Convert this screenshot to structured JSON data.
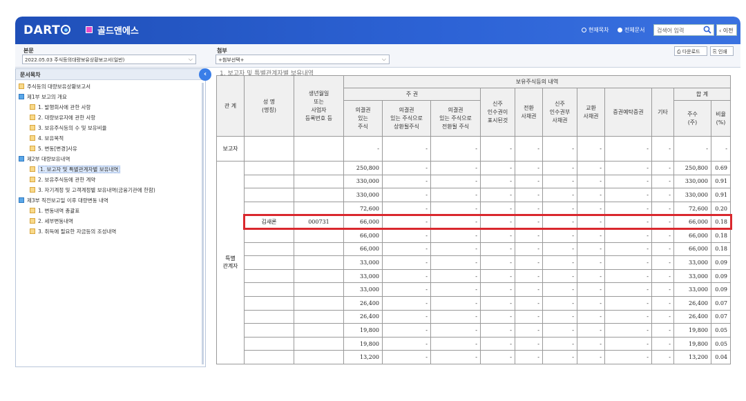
{
  "header": {
    "logo": "DART",
    "company_name": "골드앤에스",
    "radio_current": "현재목차",
    "radio_all": "전체문서",
    "search_placeholder": "검색어 입력",
    "prev_label": "이전"
  },
  "subbar": {
    "report_label": "본문",
    "report_value": "2022.05.03  주식등의대량보유상황보고서(일반)",
    "attach_label": "첨부",
    "attach_value": "+첨부선택+",
    "download_label": "다운로드",
    "print_label": "인쇄"
  },
  "sidebar": {
    "title": "문서목차",
    "items": [
      {
        "label": "주식등의 대량보유상황보고서",
        "type": "doc",
        "level": 0
      },
      {
        "label": "제1부 보고의 개요",
        "type": "folder",
        "level": 0
      },
      {
        "label": "1. 발행회사에 관한 사항",
        "type": "doc",
        "level": 1
      },
      {
        "label": "2. 대량보유자에 관한 사항",
        "type": "doc",
        "level": 1
      },
      {
        "label": "3. 보유주식등의 수 및 보유비율",
        "type": "doc",
        "level": 1
      },
      {
        "label": "4. 보유목적",
        "type": "doc",
        "level": 1
      },
      {
        "label": "5. 변동[변경]사유",
        "type": "doc",
        "level": 1
      },
      {
        "label": "제2부 대량보유내역",
        "type": "folder",
        "level": 0
      },
      {
        "label": "1. 보고자 및 특별관계자별 보유내역",
        "type": "doc",
        "level": 1,
        "selected": true
      },
      {
        "label": "2. 보유주식등에 관한 계약",
        "type": "doc",
        "level": 1
      },
      {
        "label": "3. 자기계정 및 고객계정별 보유내역(금융기관에 한함)",
        "type": "doc",
        "level": 1
      },
      {
        "label": "제3부 직전보고일 이후 대량변동 내역",
        "type": "folder",
        "level": 0
      },
      {
        "label": "1. 변동내역 총괄표",
        "type": "doc",
        "level": 1
      },
      {
        "label": "2. 세부변동내역",
        "type": "doc",
        "level": 1
      },
      {
        "label": "3. 취득에 필요한 자금등의 조성내역",
        "type": "doc",
        "level": 1
      }
    ]
  },
  "main": {
    "cut_title": "1. 보고자 및 특별관계자별 보유내역",
    "headers": {
      "relation": "관 계",
      "name": "성 명\n(명칭)",
      "birth": "생년월일\n또는\n사업자\n등록번호 등",
      "holdings": "보유주식등의 내역",
      "stock": "주 권",
      "voting": "의결권\n있는\n주식",
      "convertible_voting": "의결권\n있는 주식으로\n상환될주식",
      "exchange_voting": "의결권\n있는 주식으로\n전환될 주식",
      "new_stock": "신주\n인수권이\n표시된것",
      "cb": "전환\n사채권",
      "bw": "신주\n인수권부\n사채권",
      "eb": "교환\n사채권",
      "dr": "증권예탁증권",
      "etc": "기타",
      "total": "합 계",
      "total_shares": "주수\n(주)",
      "total_ratio": "비율\n(%)"
    },
    "reporter_label": "보고자",
    "special_label": "특별\n관계자",
    "dash": "-",
    "reporter_row": {
      "voting": "-",
      "total_shares": "-",
      "total_ratio": "-"
    },
    "rows": [
      {
        "name": "",
        "id": "",
        "voting": "250,800",
        "total_shares": "250,800",
        "total_ratio": "0.69"
      },
      {
        "name": "",
        "id": "",
        "voting": "330,000",
        "total_shares": "330,000",
        "total_ratio": "0.91"
      },
      {
        "name": "",
        "id": "",
        "voting": "330,000",
        "total_shares": "330,000",
        "total_ratio": "0.91"
      },
      {
        "name": "",
        "id": "",
        "voting": "72,600",
        "total_shares": "72,600",
        "total_ratio": "0.20"
      },
      {
        "name": "김새론",
        "id": "000731",
        "voting": "66,000",
        "total_shares": "66,000",
        "total_ratio": "0.18",
        "highlight": true
      },
      {
        "name": "",
        "id": "",
        "voting": "66,000",
        "total_shares": "66,000",
        "total_ratio": "0.18"
      },
      {
        "name": "",
        "id": "",
        "voting": "66,000",
        "total_shares": "66,000",
        "total_ratio": "0.18"
      },
      {
        "name": "",
        "id": "",
        "voting": "33,000",
        "total_shares": "33,000",
        "total_ratio": "0.09"
      },
      {
        "name": "",
        "id": "",
        "voting": "33,000",
        "total_shares": "33,000",
        "total_ratio": "0.09"
      },
      {
        "name": "",
        "id": "",
        "voting": "33,000",
        "total_shares": "33,000",
        "total_ratio": "0.09"
      },
      {
        "name": "",
        "id": "",
        "voting": "26,400",
        "total_shares": "26,400",
        "total_ratio": "0.07"
      },
      {
        "name": "",
        "id": "",
        "voting": "26,400",
        "total_shares": "26,400",
        "total_ratio": "0.07"
      },
      {
        "name": "",
        "id": "",
        "voting": "19,800",
        "total_shares": "19,800",
        "total_ratio": "0.05"
      },
      {
        "name": "",
        "id": "",
        "voting": "19,800",
        "total_shares": "19,800",
        "total_ratio": "0.05"
      },
      {
        "name": "",
        "id": "",
        "voting": "13,200",
        "total_shares": "13,200",
        "total_ratio": "0.04"
      }
    ]
  },
  "colors": {
    "header_blue": "#2d63d6",
    "highlight_red": "#d9272d",
    "selected_bg": "#dbe8fb"
  }
}
